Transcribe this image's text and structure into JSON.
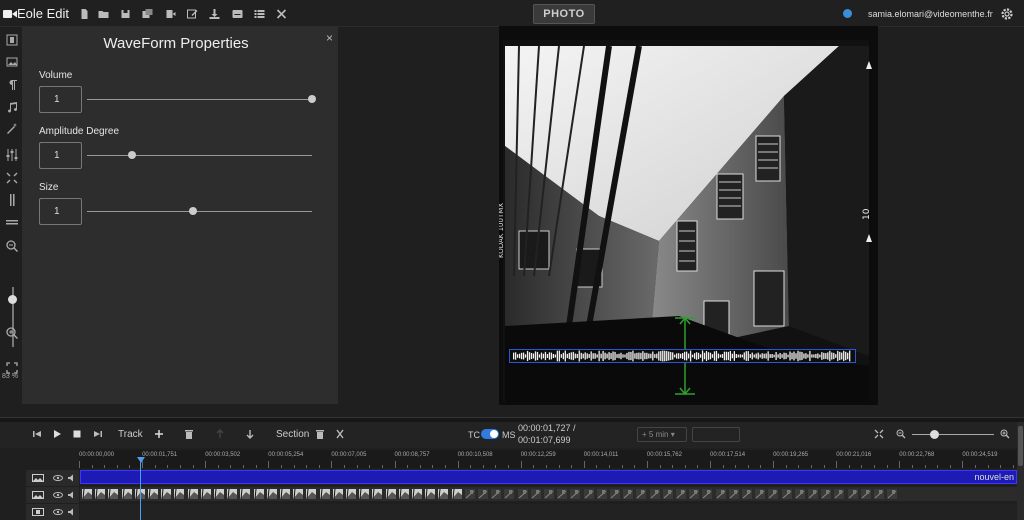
{
  "app": {
    "title": "Eole Edit",
    "mode_button": "PHOTO",
    "user_email": "samia.elomari@videomenthe.fr"
  },
  "toolbar_icons": [
    "file-icon",
    "open-folder-icon",
    "save-icon",
    "save-as-icon",
    "export-icon",
    "edit-icon",
    "download-icon",
    "subtitle-icon",
    "list-icon",
    "close-icon"
  ],
  "left_tools": {
    "icons": [
      "film-icon",
      "image-icon",
      "paragraph-icon",
      "music-icon",
      "magic-wand-icon",
      "equalizer-icon",
      "crop-icon",
      "pause-icon",
      "menu-icon",
      "zoom-out-icon",
      "zoom-in-icon",
      "fullscreen-icon"
    ],
    "zoom_percent": "83 %",
    "zoom_level": 0.2
  },
  "panel": {
    "title": "WaveForm Properties",
    "close": "×",
    "properties": [
      {
        "label": "Volume",
        "value": "1",
        "slider": 1.0
      },
      {
        "label": "Amplitude Degree",
        "value": "1",
        "slider": 0.2
      },
      {
        "label": "Size",
        "value": "1",
        "slider": 0.47
      }
    ]
  },
  "timeline": {
    "track_label": "Track",
    "section_label": "Section",
    "tc_label": "TC",
    "ms_label": "MS",
    "time_current": "00:00:01,727 /",
    "time_total": "00:01:07,699",
    "jump": "+ 5 min",
    "jump_caret": "▾",
    "zoom_level": 0.27,
    "ruler": [
      "00:00:00,000",
      "00:00:01,751",
      "00:00:03,502",
      "00:00:05,254",
      "00:00:07,005",
      "00:00:08,757",
      "00:00:10,508",
      "00:00:12,259",
      "00:00:14,011",
      "00:00:15,762",
      "00:00:17,514",
      "00:00:19,265",
      "00:00:21,016",
      "00:00:22,768",
      "00:00:24,519"
    ],
    "tracks": [
      {
        "label": "nouvel-en",
        "color": "#1d1bb4"
      },
      {
        "label": "",
        "color": "#2b2b2b"
      }
    ]
  },
  "colors": {
    "accent": "#2f7de0",
    "waveform_border": "#2c55d8",
    "track_blue": "#1d1bb4",
    "marker_green": "#2ea02e"
  }
}
